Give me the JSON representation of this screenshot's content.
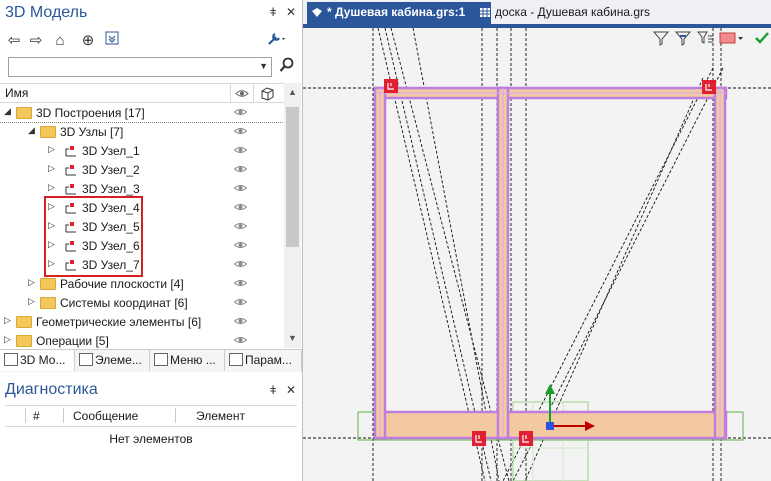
{
  "left_panel": {
    "title": "3D Модель",
    "pin_glyph": "ǂ",
    "close_glyph": "✕",
    "toolbar_icons": [
      "arrow-left-icon",
      "arrow-right-icon",
      "home-icon",
      "target-icon",
      "filter-down-icon",
      "wrench-icon"
    ],
    "search": {
      "value": "",
      "placeholder": ""
    },
    "column_name": "Имя",
    "tree": [
      {
        "label": "3D Построения [17]",
        "level": 0,
        "expanded": true,
        "type": "folder",
        "selected": true
      },
      {
        "label": "3D Узлы [7]",
        "level": 1,
        "expanded": true,
        "type": "folder"
      },
      {
        "label": "3D Узел_1",
        "level": 2,
        "expanded": false,
        "type": "node"
      },
      {
        "label": "3D Узел_2",
        "level": 2,
        "expanded": false,
        "type": "node"
      },
      {
        "label": "3D Узел_3",
        "level": 2,
        "expanded": false,
        "type": "node"
      },
      {
        "label": "3D Узел_4",
        "level": 2,
        "expanded": false,
        "type": "node"
      },
      {
        "label": "3D Узел_5",
        "level": 2,
        "expanded": false,
        "type": "node"
      },
      {
        "label": "3D Узел_6",
        "level": 2,
        "expanded": false,
        "type": "node"
      },
      {
        "label": "3D Узел_7",
        "level": 2,
        "expanded": false,
        "type": "node"
      },
      {
        "label": "Рабочие плоскости [4]",
        "level": 1,
        "expanded": false,
        "type": "folder"
      },
      {
        "label": "Системы координат [6]",
        "level": 1,
        "expanded": false,
        "type": "folder"
      },
      {
        "label": "Геометрические элементы [6]",
        "level": 0,
        "expanded": false,
        "type": "folder"
      },
      {
        "label": "Операции [5]",
        "level": 0,
        "expanded": false,
        "type": "folder"
      }
    ],
    "bottom_tabs": [
      "3D Мо...",
      "Элеме...",
      "Меню ...",
      "Парам..."
    ]
  },
  "diagnostics": {
    "title": "Диагностика",
    "columns": [
      "#",
      "Сообщение",
      "Элемент"
    ],
    "empty_text": "Нет элементов"
  },
  "document_tabs": [
    {
      "label": "* Душевая кабина.grs:1",
      "active": true
    },
    {
      "label": "доска - Душевая кабина.grs",
      "active": false
    }
  ],
  "colors": {
    "accent": "#2b579a",
    "frame_fill": "#f3c9a2",
    "frame_stroke": "#c07de0",
    "node_marker": "#e02030",
    "axis_red": "#c00000",
    "axis_green": "#1a9e2a",
    "axis_blue": "#3050e0"
  }
}
